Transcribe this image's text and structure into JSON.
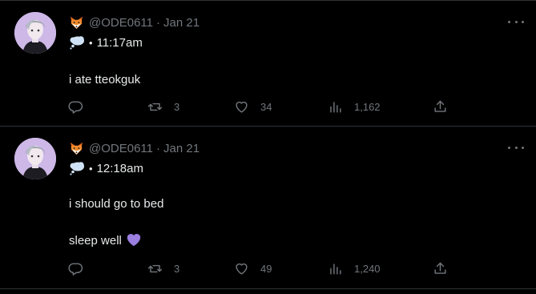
{
  "colors": {
    "background": "#000000",
    "text_primary": "#e7e9ea",
    "text_secondary": "#71767b",
    "divider": "#2f3336",
    "heart_purple": "#9a7ee0"
  },
  "icons": {
    "badge": "fox-emoji-icon",
    "status": "thought-bubble-icon",
    "menu": "more-horizontal-icon",
    "reply": "reply-icon",
    "retweet": "retweet-icon",
    "like": "heart-icon",
    "views": "views-chart-icon",
    "share": "share-icon",
    "inline_emoji": "purple-heart-icon"
  },
  "tweets": [
    {
      "handle": "@ODE0611",
      "separator": "·",
      "date": "Jan 21",
      "bullet": "•",
      "time": "11:17am",
      "lines": [
        "i ate tteokguk"
      ],
      "stats": {
        "reply": "",
        "retweets": "3",
        "likes": "34",
        "views": "1,162"
      }
    },
    {
      "handle": "@ODE0611",
      "separator": "·",
      "date": "Jan 21",
      "bullet": "•",
      "time": "12:18am",
      "lines": [
        "i should go to bed",
        "sleep well"
      ],
      "stats": {
        "reply": "",
        "retweets": "3",
        "likes": "49",
        "views": "1,240"
      }
    }
  ]
}
